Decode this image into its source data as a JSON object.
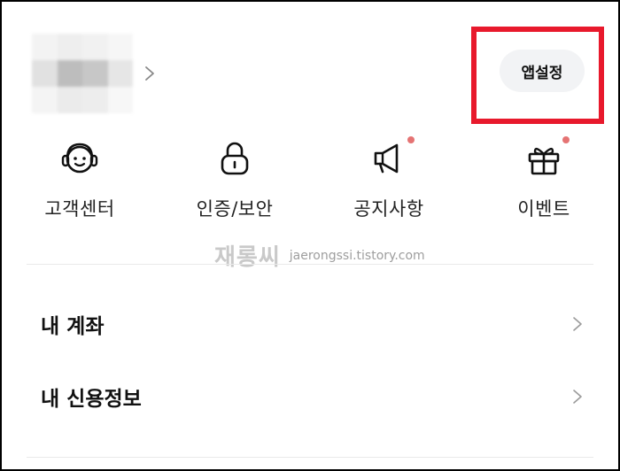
{
  "header": {
    "app_settings_label": "앱설정"
  },
  "quick_menu": {
    "items": [
      {
        "label": "고객센터",
        "icon": "customer-service-icon"
      },
      {
        "label": "인증/보안",
        "icon": "lock-icon"
      },
      {
        "label": "공지사항",
        "icon": "megaphone-icon",
        "badge": true
      },
      {
        "label": "이벤트",
        "icon": "gift-icon",
        "badge": true
      }
    ]
  },
  "watermark": {
    "logo_text": "재롱씨",
    "url": "jaerongssi.tistory.com"
  },
  "menu_list": {
    "items": [
      {
        "label": "내 계좌"
      },
      {
        "label": "내 신용정보"
      }
    ]
  },
  "colors": {
    "highlight": "#e8192c",
    "badge_dot": "#e57373",
    "pill_bg": "#f2f3f5"
  }
}
